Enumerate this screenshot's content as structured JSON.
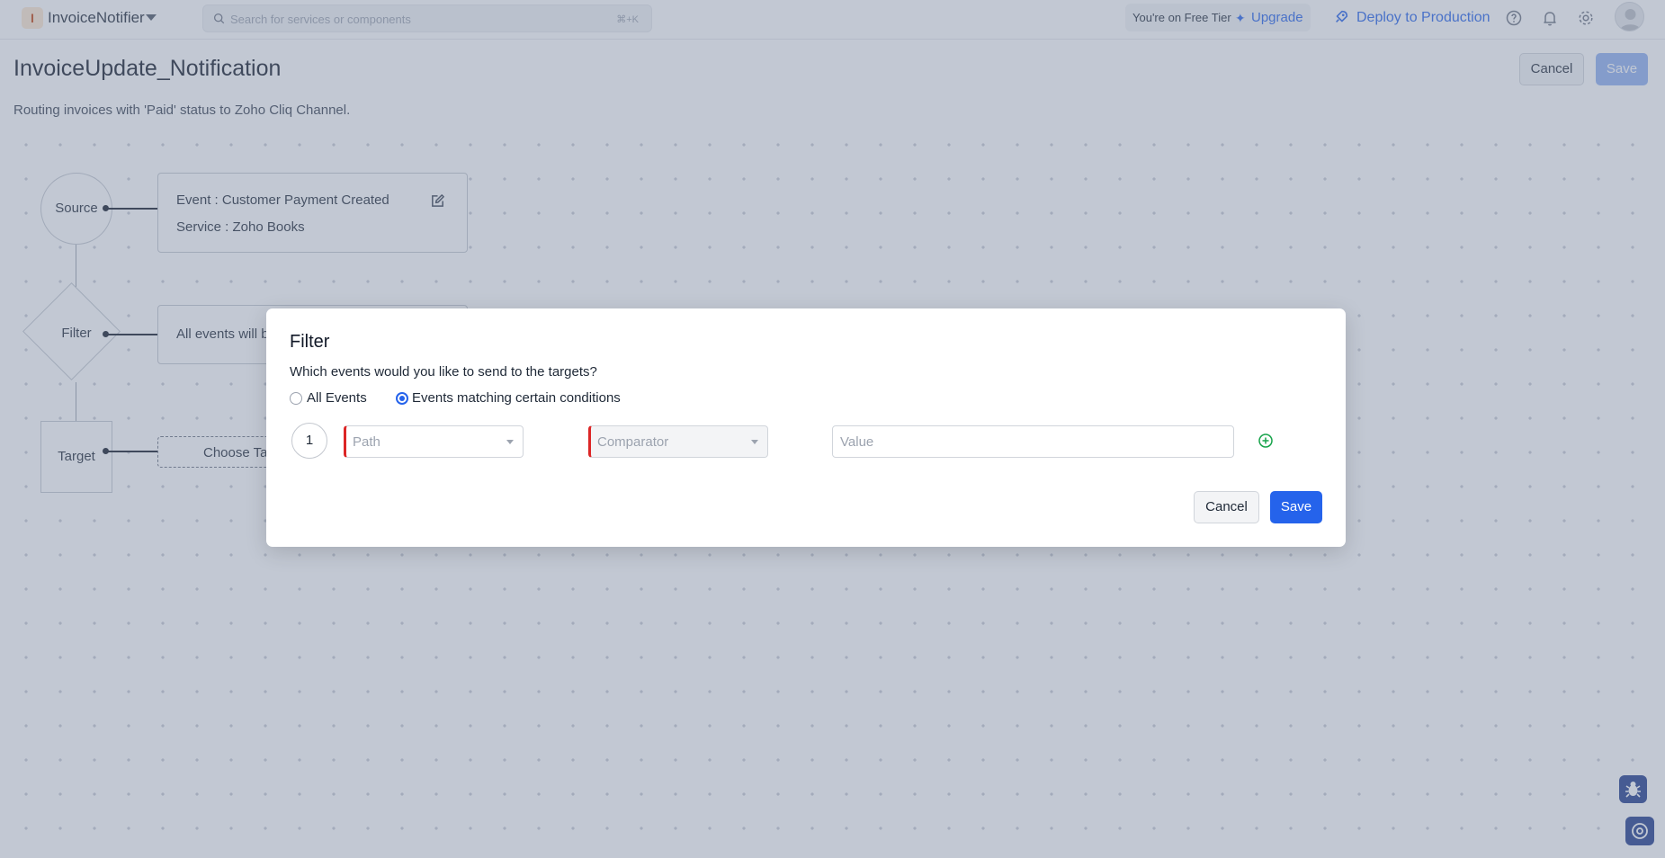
{
  "app": {
    "badge": "I",
    "name": "InvoiceNotifier"
  },
  "search": {
    "placeholder": "Search for services or components",
    "shortcut": "⌘+K"
  },
  "tier": {
    "text": "You're on Free Tier",
    "upgrade": "Upgrade"
  },
  "toolbar": {
    "deploy": "Deploy to Production"
  },
  "page": {
    "title": "InvoiceUpdate_Notification",
    "description": "Routing invoices with 'Paid' status to Zoho Cliq Channel.",
    "cancel": "Cancel",
    "save": "Save"
  },
  "flow": {
    "source": {
      "label": "Source",
      "event": "Event : Customer Payment Created",
      "service": "Service : Zoho Books"
    },
    "filter": {
      "label": "Filter",
      "summary": "All events will b"
    },
    "target": {
      "label": "Target",
      "choose": "Choose Ta"
    }
  },
  "modal": {
    "title": "Filter",
    "question": "Which events would you like to send to the targets?",
    "options": [
      {
        "label": "All Events",
        "selected": false
      },
      {
        "label": "Events matching certain conditions",
        "selected": true
      }
    ],
    "row": {
      "index": "1",
      "path_placeholder": "Path",
      "comparator_placeholder": "Comparator",
      "value_placeholder": "Value"
    },
    "cancel": "Cancel",
    "save": "Save"
  },
  "colors": {
    "accent": "#2563eb",
    "required": "#dc2626",
    "overlay": "#78849e"
  }
}
